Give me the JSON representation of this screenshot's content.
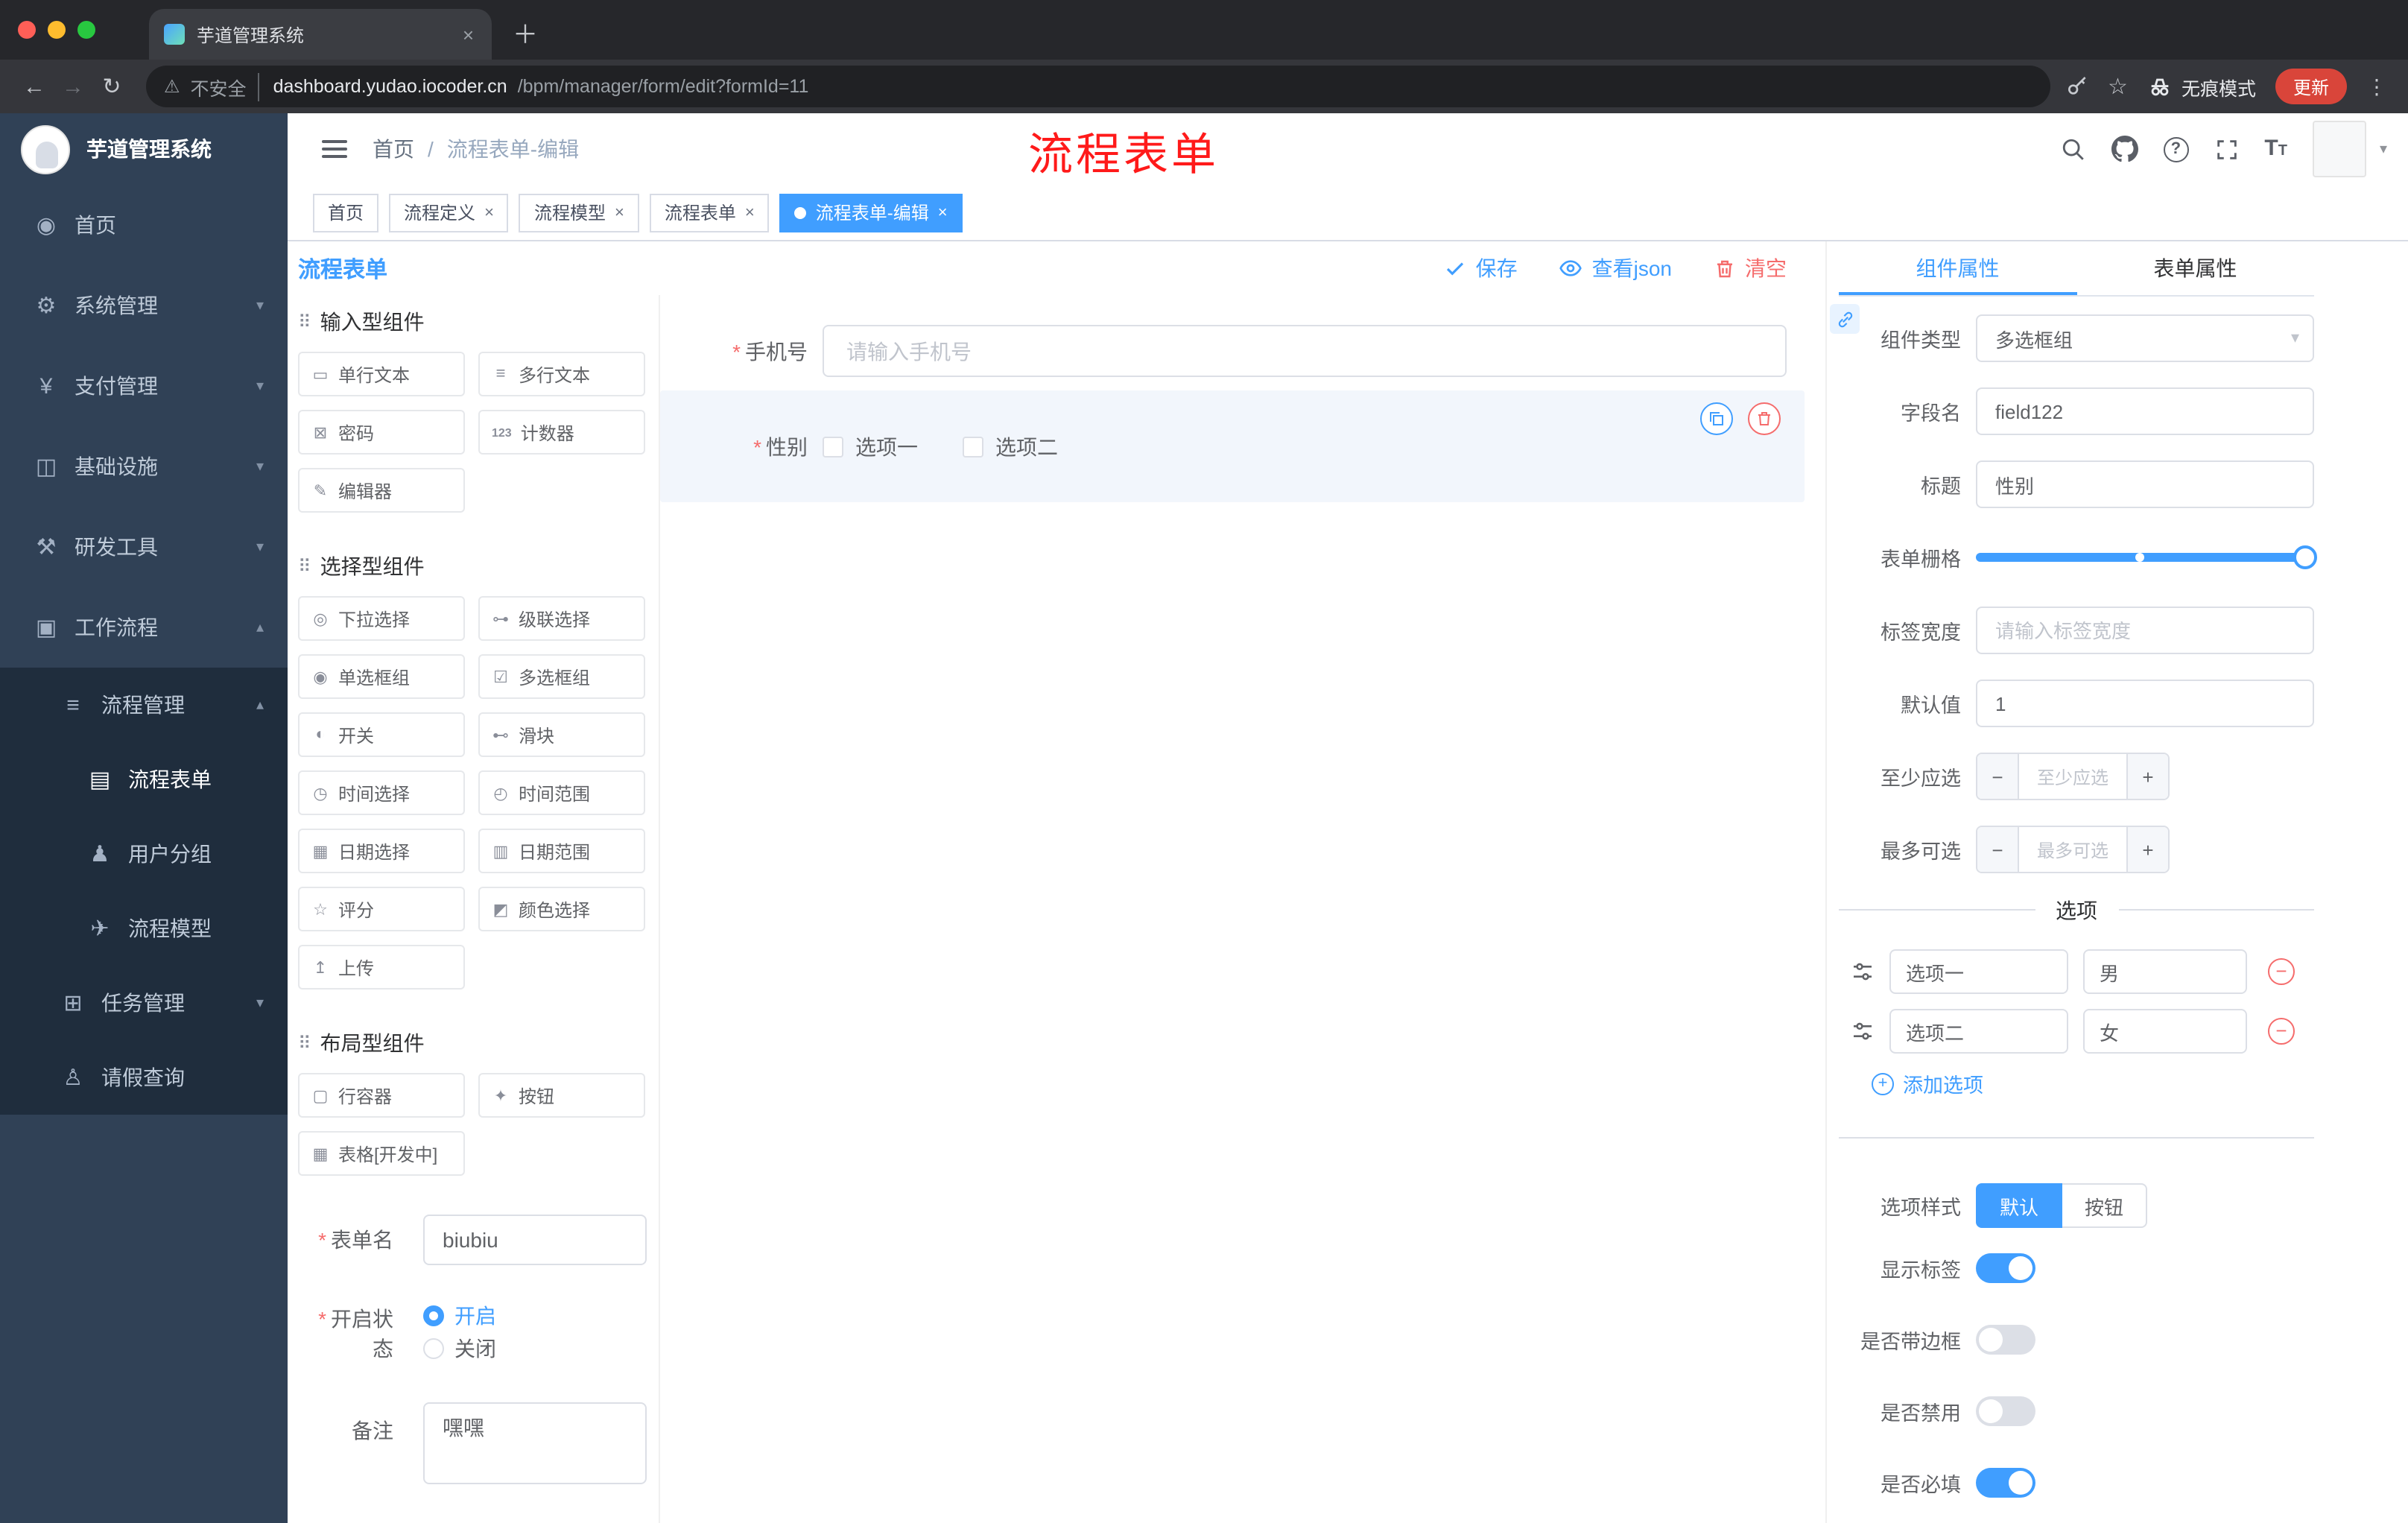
{
  "browser": {
    "tab_title": "芋道管理系统",
    "security_label": "不安全",
    "url_host": "dashboard.yudao.iocoder.cn",
    "url_path": "/bpm/manager/form/edit?formId=11",
    "incognito_label": "无痕模式",
    "update_label": "更新"
  },
  "sidebar": {
    "logo_title": "芋道管理系统",
    "items": [
      {
        "icon": "◉",
        "label": "首页"
      },
      {
        "icon": "⚙",
        "label": "系统管理"
      },
      {
        "icon": "¥",
        "label": "支付管理"
      },
      {
        "icon": "◫",
        "label": "基础设施"
      },
      {
        "icon": "⚒",
        "label": "研发工具"
      },
      {
        "icon": "▣",
        "label": "工作流程"
      },
      {
        "icon": "≡",
        "label": "流程管理"
      },
      {
        "icon": "▤",
        "label": "流程表单"
      },
      {
        "icon": "♟",
        "label": "用户分组"
      },
      {
        "icon": "✈",
        "label": "流程模型"
      },
      {
        "icon": "⊞",
        "label": "任务管理"
      },
      {
        "icon": "♙",
        "label": "请假查询"
      }
    ]
  },
  "header": {
    "breadcrumb_first": "首页",
    "breadcrumb_last": "流程表单-编辑",
    "overlay_title": "流程表单"
  },
  "tags": [
    {
      "label": "首页"
    },
    {
      "label": "流程定义"
    },
    {
      "label": "流程模型"
    },
    {
      "label": "流程表单"
    },
    {
      "label": "流程表单-编辑"
    }
  ],
  "editor": {
    "panel_title": "流程表单",
    "actions": {
      "save": "保存",
      "view_json": "查看json",
      "clear": "清空"
    },
    "palette": {
      "groups": [
        {
          "title": "输入型组件",
          "items": [
            {
              "icon": "▭",
              "label": "单行文本"
            },
            {
              "icon": "≡",
              "label": "多行文本"
            },
            {
              "icon": "⊠",
              "label": "密码"
            },
            {
              "icon": "123",
              "label": "计数器"
            },
            {
              "icon": "✎",
              "label": "编辑器"
            }
          ]
        },
        {
          "title": "选择型组件",
          "items": [
            {
              "icon": "◎",
              "label": "下拉选择"
            },
            {
              "icon": "⊶",
              "label": "级联选择"
            },
            {
              "icon": "◉",
              "label": "单选框组"
            },
            {
              "icon": "☑",
              "label": "多选框组"
            },
            {
              "icon": "◐",
              "label": "开关"
            },
            {
              "icon": "⊷",
              "label": "滑块"
            },
            {
              "icon": "◷",
              "label": "时间选择"
            },
            {
              "icon": "◴",
              "label": "时间范围"
            },
            {
              "icon": "▦",
              "label": "日期选择"
            },
            {
              "icon": "▥",
              "label": "日期范围"
            },
            {
              "icon": "☆",
              "label": "评分"
            },
            {
              "icon": "◩",
              "label": "颜色选择"
            },
            {
              "icon": "↥",
              "label": "上传"
            }
          ]
        },
        {
          "title": "布局型组件",
          "items": [
            {
              "icon": "▢",
              "label": "行容器"
            },
            {
              "icon": "✦",
              "label": "按钮"
            },
            {
              "icon": "▦",
              "label": "表格[开发中]"
            }
          ]
        }
      ]
    },
    "meta": {
      "name_label": "表单名",
      "name_value": "biubiu",
      "status_label": "开启状态",
      "status_on": "开启",
      "status_off": "关闭",
      "remark_label": "备注",
      "remark_value": "嘿嘿"
    },
    "canvas": {
      "phone_label": "手机号",
      "phone_placeholder": "请输入手机号",
      "gender_label": "性别",
      "gender_option1": "选项一",
      "gender_option2": "选项二"
    }
  },
  "props": {
    "tab_component": "组件属性",
    "tab_form": "表单属性",
    "component_type_label": "组件类型",
    "component_type_value": "多选框组",
    "field_name_label": "字段名",
    "field_name_value": "field122",
    "title_label": "标题",
    "title_value": "性别",
    "grid_label": "表单栅格",
    "label_width_label": "标签宽度",
    "label_width_placeholder": "请输入标签宽度",
    "default_label": "默认值",
    "default_value": "1",
    "min_label": "至少应选",
    "min_placeholder": "至少应选",
    "max_label": "最多可选",
    "max_placeholder": "最多可选",
    "options_title": "选项",
    "options": [
      {
        "label": "选项一",
        "value": "男"
      },
      {
        "label": "选项二",
        "value": "女"
      }
    ],
    "add_option": "添加选项",
    "style_label": "选项样式",
    "style_default": "默认",
    "style_button": "按钮",
    "show_label_label": "显示标签",
    "border_label": "是否带边框",
    "disabled_label": "是否禁用",
    "required_label": "是否必填"
  },
  "colors": {
    "accent": "#409eff",
    "danger": "#f56c6c",
    "annotation_red": "#ff1a1a",
    "sidebar_bg": "#304156",
    "submenu_bg": "#1f2d3d"
  }
}
